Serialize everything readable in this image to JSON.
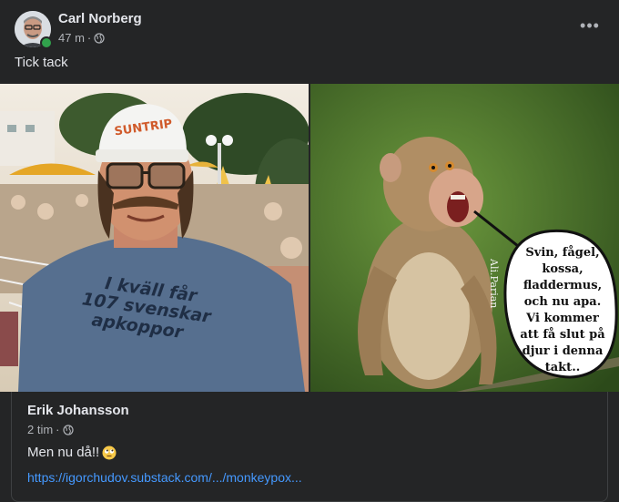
{
  "post": {
    "author": "Carl Norberg",
    "time": "47 m",
    "separator": "·",
    "text": "Tick tack",
    "more_label": "•••"
  },
  "image_right": {
    "watermark": "Ali.Parian",
    "bubble_lines": [
      "Svin, fågel,",
      "kossa,",
      "fladdermus,",
      "och nu apa.",
      "Vi kommer",
      "att få slut på",
      "djur i denna",
      "takt.."
    ]
  },
  "image_left": {
    "cap_text": "SUNTRIP",
    "shirt_lines": [
      "I kväll får",
      "107 svenskar",
      "apkoppor"
    ]
  },
  "shared": {
    "author": "Erik Johansson",
    "time": "2 tim",
    "separator": "·",
    "text": "Men nu då!!",
    "link": "https://igorchudov.substack.com/.../monkeypox..."
  },
  "colors": {
    "background": "#242526",
    "link": "#4599ff",
    "online": "#31a24c"
  },
  "icons": [
    "globe-icon",
    "more-icon",
    "rolling-eyes-emoji-icon"
  ]
}
